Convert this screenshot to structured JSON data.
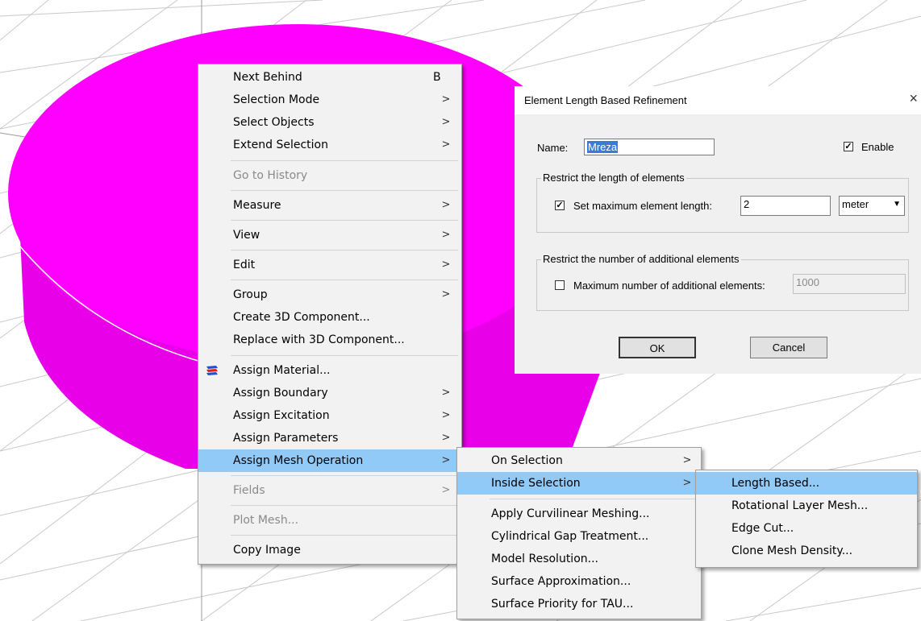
{
  "context_menu": {
    "items": [
      {
        "label": "Next Behind",
        "accel": "B"
      },
      {
        "label": "Selection Mode",
        "arrow": ">"
      },
      {
        "label": "Select Objects",
        "arrow": ">"
      },
      {
        "label": "Extend Selection",
        "arrow": ">"
      },
      {
        "label": "Go to History"
      },
      {
        "label": "Measure",
        "arrow": ">"
      },
      {
        "label": "View",
        "arrow": ">"
      },
      {
        "label": "Edit",
        "arrow": ">"
      },
      {
        "label": "Group",
        "arrow": ">"
      },
      {
        "label": "Create 3D Component..."
      },
      {
        "label": "Replace with 3D Component..."
      },
      {
        "label": "Assign Material...",
        "icon": "material-icon"
      },
      {
        "label": "Assign Boundary",
        "arrow": ">"
      },
      {
        "label": "Assign Excitation",
        "arrow": ">"
      },
      {
        "label": "Assign Parameters",
        "arrow": ">"
      },
      {
        "label": "Assign Mesh Operation",
        "arrow": ">"
      },
      {
        "label": "Fields",
        "arrow": ">"
      },
      {
        "label": "Plot Mesh..."
      },
      {
        "label": "Copy Image"
      }
    ]
  },
  "mesh_submenu": {
    "items": [
      {
        "label": "On Selection",
        "arrow": ">"
      },
      {
        "label": "Inside Selection",
        "arrow": ">"
      },
      {
        "label": "Apply Curvilinear Meshing..."
      },
      {
        "label": "Cylindrical Gap Treatment..."
      },
      {
        "label": "Model Resolution..."
      },
      {
        "label": "Surface Approximation..."
      },
      {
        "label": "Surface Priority for TAU..."
      }
    ]
  },
  "inside_submenu": {
    "items": [
      {
        "label": "Length Based..."
      },
      {
        "label": "Rotational Layer Mesh..."
      },
      {
        "label": "Edge Cut..."
      },
      {
        "label": "Clone Mesh Density..."
      }
    ]
  },
  "dialog": {
    "title": "Element Length Based Refinement",
    "close": "×",
    "name_label": "Name:",
    "name_value": "Mreza",
    "enable_label": "Enable",
    "enable_checked": "✓",
    "group1_title": "Restrict the length of elements",
    "set_max_label": "Set maximum element length:",
    "set_max_checked": "✓",
    "max_length_value": "2",
    "unit_value": "meter",
    "unit_arrow": "▼",
    "group2_title": "Restrict the number of additional elements",
    "max_num_label": "Maximum number of additional elements:",
    "max_num_value": "1000",
    "ok_label": "OK",
    "cancel_label": "Cancel"
  },
  "colors": {
    "object": "#ff00ff",
    "object_side": "#e700e8",
    "highlight": "#91c9f7"
  }
}
